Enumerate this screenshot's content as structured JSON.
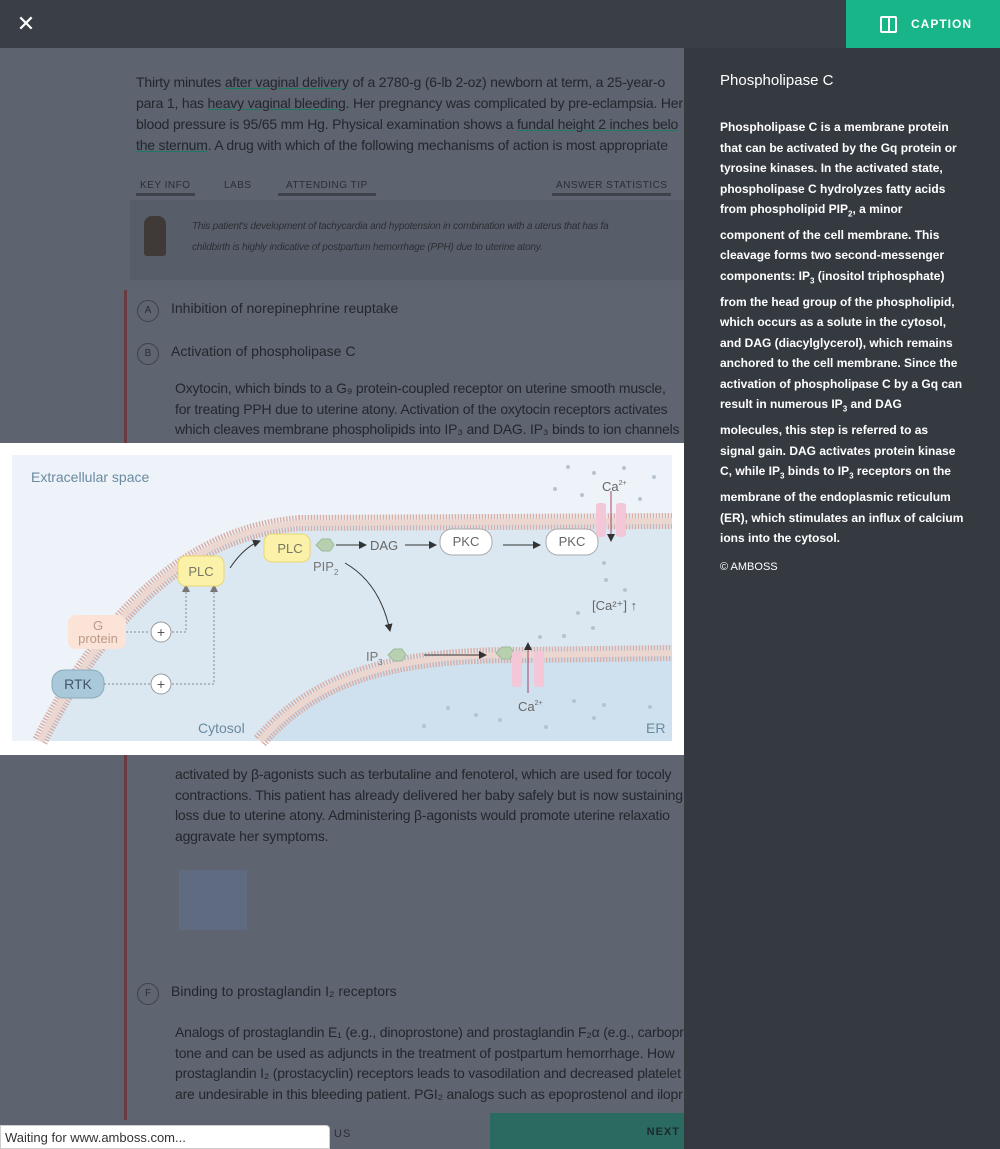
{
  "topbar": {
    "close_icon": "close-icon",
    "caption_label": "CAPTION",
    "caption_icon": "sidebar-panel-icon"
  },
  "question": {
    "text_parts": [
      "Thirty minutes ",
      "after vaginal delivery",
      " of a 2780-g (6-lb 2-oz) newborn at term, a 25-year-o"
    ],
    "line2": [
      "para 1, has ",
      "heavy vaginal bleeding",
      ". Her pregnancy was complicated by pre-eclampsia. Her"
    ],
    "line3": [
      "blood pressure is 95/65 mm Hg. Physical examination shows a ",
      "fundal height 2 inches belo"
    ],
    "line4": [
      "the sternum",
      ". A drug with which of the following mechanisms of action is most appropriate"
    ]
  },
  "tabs": [
    "KEY INFO",
    "LABS",
    "ATTENDING TIP",
    "ANSWER STATISTICS"
  ],
  "tip": {
    "line1": "This patient's development of tachycardia and hypotension in combination with a uterus that has fa",
    "line2": "childbirth is highly indicative of postpartum hemorrhage (PPH) due to uterine atony."
  },
  "options": [
    {
      "letter": "A",
      "text": "Inhibition of norepinephrine reuptake"
    },
    {
      "letter": "B",
      "text": "Activation of phospholipase C"
    },
    {
      "letter": "F",
      "text": "Binding to prostaglandin I₂ receptors"
    }
  ],
  "explanation_b": [
    "Oxytocin, which binds to a G₉ protein-coupled receptor on uterine smooth muscle,",
    "for treating PPH due to uterine atony. Activation of the oxytocin receptors activates",
    "which cleaves membrane phospholipids into IP₃ and DAG. IP₃ binds to ion channels"
  ],
  "explanation_c": [
    "activated by β-agonists such as terbutaline and fenoterol, which are used for tocoly",
    "contractions. This patient has already delivered her baby safely but is now sustaining",
    "loss due to uterine atony. Administering β-agonists would promote uterine relaxatio",
    "aggravate her symptoms."
  ],
  "explanation_f": [
    "Analogs of prostaglandin E₁ (e.g., dinoprostone) and prostaglandin F₂α (e.g., carbopro",
    "tone and can be used as adjuncts in the treatment of postpartum hemorrhage. How",
    "prostaglandin I₂ (prostacyclin) receptors leads to vasodilation and decreased platelet",
    "are undesirable in this bleeding patient. PGI₂ analogs such as epoprostenol and ilopr"
  ],
  "footer": {
    "prev_label": "US",
    "next_label": "NEXT"
  },
  "diagram": {
    "extracellular": "Extracellular space",
    "cytosol": "Cytosol",
    "er": "ER",
    "plc": "PLC",
    "g_protein_1": "G",
    "g_protein_2": "protein",
    "rtk": "RTK",
    "dag": "DAG",
    "pkc": "PKC",
    "pip": "PIP",
    "pip_sub": "2",
    "ip": "IP",
    "ip_sub": "3",
    "ca": "Ca",
    "ca_sup": "2+",
    "ca_conc": "[Ca²⁺] ↑",
    "plus": "+"
  },
  "caption": {
    "title": "Phospholipase C",
    "body": [
      "Phospholipase C is a membrane protein that can be activated by the Gq protein or tyrosine kinases. In the activated state, phospholipase C hydrolyzes fatty acids from phospholipid PIP",
      "2",
      ", a minor component of the cell membrane. This cleavage forms two second-messenger components: IP",
      "3",
      " (inositol triphosphate) from the head group of the phospholipid, which occurs as a solute in the cytosol, and DAG (diacylglycerol), which remains anchored to the cell membrane. Since the activation of phospholipase C by a Gq can result in numerous IP",
      "3",
      " and DAG molecules, this step is referred to as signal gain. DAG activates protein kinase C, while IP",
      "3",
      " binds to IP",
      "3",
      " receptors on the membrane of the endoplasmic reticulum (ER), which stimulates an influx of calcium ions into the cytosol."
    ],
    "copyright": "© AMBOSS"
  },
  "status_bar": "Waiting for www.amboss.com..."
}
